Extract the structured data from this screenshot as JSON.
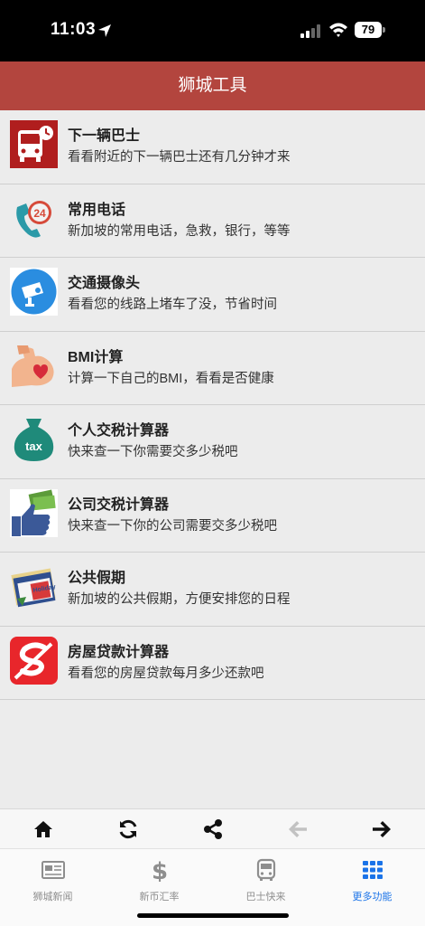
{
  "status": {
    "time": "11:03",
    "battery": "79"
  },
  "header": {
    "title": "狮城工具"
  },
  "items": [
    {
      "title": "下一辆巴士",
      "desc": "看看附近的下一辆巴士还有几分钟才来",
      "icon": "bus-clock-icon"
    },
    {
      "title": "常用电话",
      "desc": "新加坡的常用电话，急救，银行，等等",
      "icon": "phone-24-icon"
    },
    {
      "title": "交通摄像头",
      "desc": "看看您的线路上堵车了没，节省时间",
      "icon": "traffic-camera-icon"
    },
    {
      "title": "BMI计算",
      "desc": "计算一下自己的BMI，看看是否健康",
      "icon": "arm-heart-icon"
    },
    {
      "title": "个人交税计算器",
      "desc": "快来查一下你需要交多少税吧",
      "icon": "tax-bag-icon"
    },
    {
      "title": "公司交税计算器",
      "desc": "快来查一下你的公司需要交多少税吧",
      "icon": "thumbs-up-money-icon"
    },
    {
      "title": "公共假期",
      "desc": "新加坡的公共假期，方便安排您的日程",
      "icon": "holiday-calendar-icon",
      "icon_text": "Holiday"
    },
    {
      "title": "房屋贷款计算器",
      "desc": "看看您的房屋贷款每月多少还款吧",
      "icon": "loan-s-icon"
    }
  ],
  "toolbar": [
    "home-icon",
    "refresh-icon",
    "share-icon",
    "back-arrow-icon",
    "forward-arrow-icon"
  ],
  "tabs": [
    {
      "label": "狮城新闻",
      "icon": "newspaper-icon"
    },
    {
      "label": "新币汇率",
      "icon": "dollar-icon"
    },
    {
      "label": "巴士快来",
      "icon": "bus-icon"
    },
    {
      "label": "更多功能",
      "icon": "grid-icon",
      "active": true
    }
  ],
  "colors": {
    "header": "#b3453e",
    "active_tab": "#1a73e8"
  }
}
